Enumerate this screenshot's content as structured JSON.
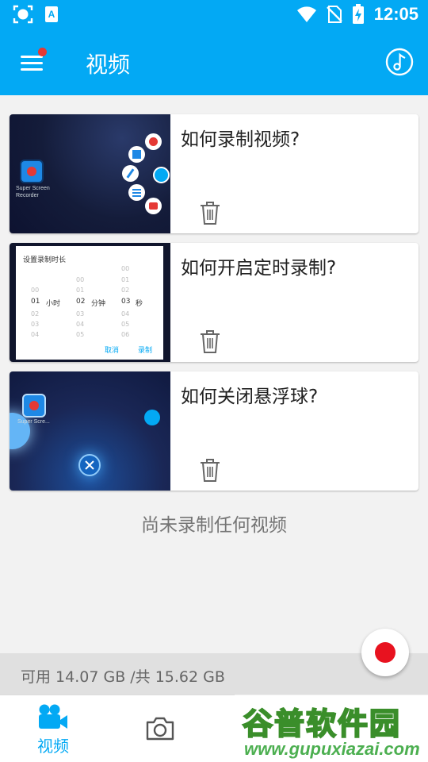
{
  "status_bar": {
    "time": "12:05",
    "icons": [
      "screen-record-icon",
      "keyboard-a-icon",
      "wifi-icon",
      "no-sim-icon",
      "battery-charging-icon"
    ]
  },
  "app_bar": {
    "title": "视频",
    "menu_icon": "hamburger-menu-icon",
    "action_icon": "music-note-icon"
  },
  "videos": [
    {
      "title": "如何录制视频?",
      "thumbnail_text": [
        "Super Screen",
        "Recorder"
      ]
    },
    {
      "title": "如何开启定时录制?",
      "thumbnail_dialog": {
        "title": "设置录制时长",
        "hour_unit": "小时",
        "minute_unit": "分钟",
        "second_unit": "秒",
        "hour_values": [
          "00",
          "01",
          "02",
          "03",
          "04"
        ],
        "minute_values": [
          "00",
          "01",
          "02",
          "03",
          "04",
          "05"
        ],
        "second_values": [
          "00",
          "01",
          "02",
          "03",
          "04",
          "05",
          "06"
        ],
        "cancel": "取消",
        "confirm": "录制"
      }
    },
    {
      "title": "如何关闭悬浮球?",
      "thumbnail_text": [
        "Super Scre..."
      ]
    }
  ],
  "empty_message": "尚未录制任何视频",
  "storage": "可用 14.07 GB /共 15.62 GB",
  "record_button": {
    "icon": "record-dot-icon"
  },
  "bottom_nav": {
    "videos_label": "视频",
    "videos_icon": "video-camera-icon",
    "photos_icon": "camera-icon",
    "accent_color": "#03a9f4"
  },
  "watermark": {
    "title": "谷普软件园",
    "url": "www.gupuxiazai.com"
  },
  "colors": {
    "primary": "#03a9f4",
    "record_red": "#e8121f",
    "background": "#f2f2f2"
  }
}
